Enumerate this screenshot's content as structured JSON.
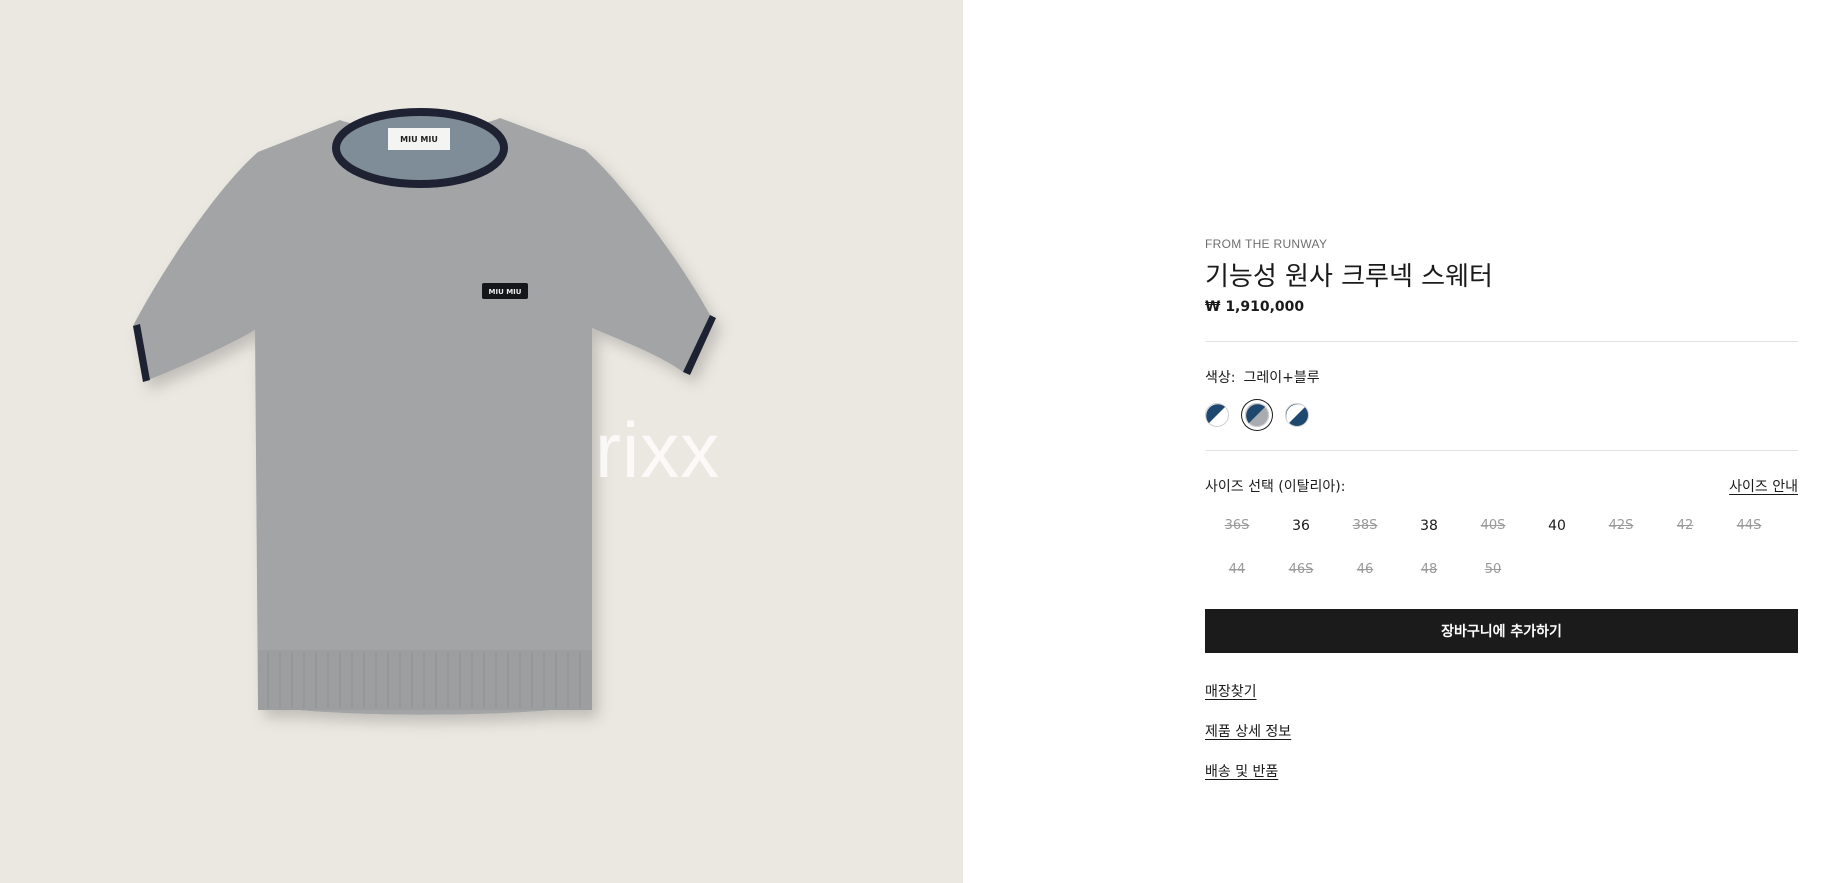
{
  "image": {
    "watermark": "rixx",
    "label_text": "MIU MIU",
    "patch_text": "MIU MIU"
  },
  "product": {
    "eyebrow": "FROM THE RUNWAY",
    "title": "기능성 원사 크루넥 스웨터",
    "price": "₩ 1,910,000"
  },
  "color": {
    "label": "색상:",
    "value": "그레이+블루",
    "swatches": [
      {
        "name": "swatch-navy-white",
        "color_a": "#1f4870",
        "color_b": "#ffffff",
        "selected": false
      },
      {
        "name": "swatch-grey-blue",
        "color_a": "#1f4870",
        "color_b": "#a8acb0",
        "selected": true
      },
      {
        "name": "swatch-navy-white-2",
        "color_a": "#ffffff",
        "color_b": "#1f4870",
        "selected": false
      }
    ]
  },
  "size": {
    "label": "사이즈 선택 (이탈리아):",
    "guide": "사이즈 안내",
    "options": [
      {
        "label": "36S",
        "available": false
      },
      {
        "label": "36",
        "available": true
      },
      {
        "label": "38S",
        "available": false
      },
      {
        "label": "38",
        "available": true
      },
      {
        "label": "40S",
        "available": false
      },
      {
        "label": "40",
        "available": true
      },
      {
        "label": "42S",
        "available": false
      },
      {
        "label": "42",
        "available": false
      },
      {
        "label": "44S",
        "available": false
      },
      {
        "label": "44",
        "available": false
      },
      {
        "label": "46S",
        "available": false
      },
      {
        "label": "46",
        "available": false
      },
      {
        "label": "48",
        "available": false
      },
      {
        "label": "50",
        "available": false
      }
    ]
  },
  "actions": {
    "add_to_cart": "장바구니에 추가하기",
    "find_store": "매장찾기",
    "product_details": "제품 상세 정보",
    "shipping_returns": "배송 및 반품"
  }
}
